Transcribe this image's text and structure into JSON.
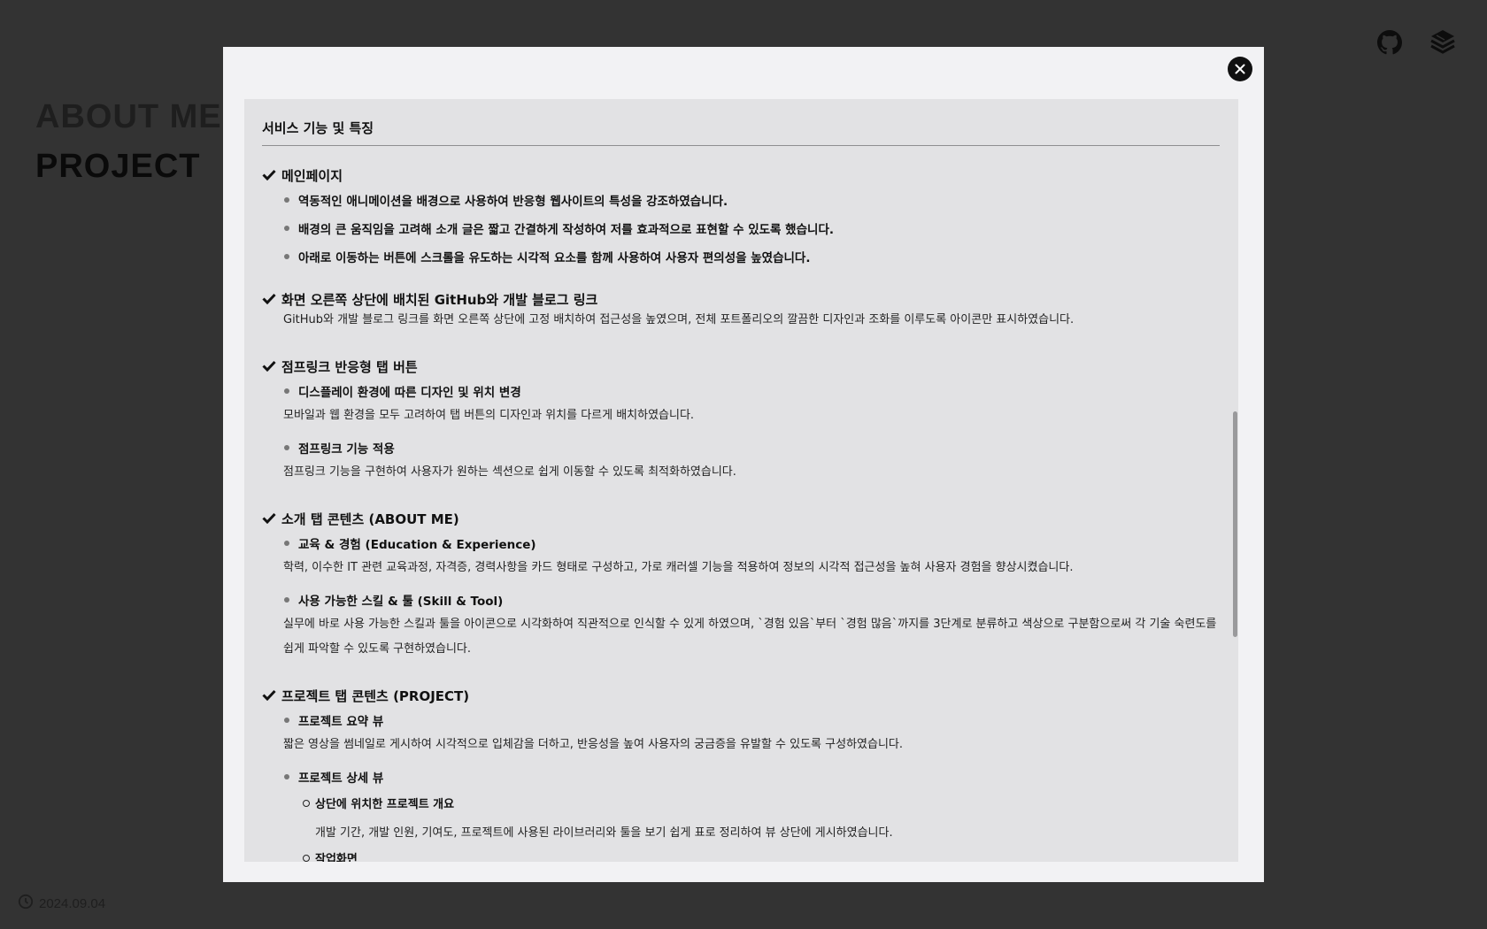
{
  "background": {
    "nav": [
      "ABOUT ME",
      "PROJECT"
    ],
    "date": "2024.09.04",
    "icons": {
      "github": "github-icon",
      "blog": "blog-stack-icon",
      "clock": "clock-icon"
    }
  },
  "modal": {
    "close_icon": "close-icon",
    "title": "서비스 기능 및 특징",
    "sections": [
      {
        "heading": "메인페이지",
        "bullets": [
          "역동적인 애니메이션을 배경으로 사용하여 반응형 웹사이트의 특성을 강조하였습니다.",
          "배경의 큰 움직임을 고려해 소개 글은 짧고 간결하게 작성하여 저를 효과적으로 표현할 수 있도록 했습니다.",
          "아래로 이동하는 버튼에 스크롤을 유도하는 시각적 요소를 함께 사용하여 사용자 편의성을 높였습니다."
        ]
      },
      {
        "heading": "화면 오른쪽 상단에 배치된 GitHub와 개발 블로그 링크",
        "desc": "GitHub와 개발 블로그 링크를 화면 오른쪽 상단에 고정 배치하여 접근성을 높였으며, 전체 포트폴리오의 깔끔한 디자인과 조화를 이루도록 아이콘만 표시하였습니다."
      },
      {
        "heading": "점프링크 반응형 탭 버튼",
        "items": [
          {
            "title": "디스플레이 환경에 따른 디자인 및 위치 변경",
            "desc": "모바일과 웹 환경을 모두 고려하여 탭 버튼의 디자인과 위치를 다르게 배치하였습니다."
          },
          {
            "title": "점프링크 기능 적용",
            "desc": "점프링크 기능을 구현하여 사용자가 원하는 섹션으로 쉽게 이동할 수 있도록 최적화하였습니다."
          }
        ]
      },
      {
        "heading": "소개 탭 콘텐츠 (ABOUT ME)",
        "items": [
          {
            "title": "교육 & 경험 (Education & Experience)",
            "desc": "학력, 이수한 IT 관련 교육과정, 자격증, 경력사항을 카드 형태로 구성하고, 가로 캐러셀 기능을 적용하여 정보의 시각적 접근성을 높혀 사용자 경험을 향상시켰습니다."
          },
          {
            "title": "사용 가능한 스킬 & 툴 (Skill & Tool)",
            "desc": "실무에 바로 사용 가능한 스킬과 툴을 아이콘으로 시각화하여 직관적으로 인식할 수 있게 하였으며, `경험 있음`부터 `경험 많음`까지를 3단계로 분류하고 색상으로 구분함으로써 각 기술 숙련도를",
            "desc2": "쉽게 파악할 수 있도록 구현하였습니다."
          }
        ]
      },
      {
        "heading": "프로젝트 탭 콘텐츠 (PROJECT)",
        "items": [
          {
            "title": "프로젝트 요약 뷰",
            "desc": "짧은 영상을 썸네일로 게시하여 시각적으로 입체감을 더하고, 반응성을 높여 사용자의 궁금증을 유발할 수 있도록 구성하였습니다."
          },
          {
            "title": "프로젝트 상세 뷰",
            "subitems": [
              {
                "title": "상단에 위치한 프로젝트 개요",
                "desc": "개발 기간, 개발 인원, 기여도, 프로젝트에 사용된 라이브러리와 툴을 보기 쉽게 표로 정리하여 뷰 상단에 게시하였습니다."
              },
              {
                "title": "작업화면"
              }
            ]
          }
        ]
      }
    ]
  }
}
